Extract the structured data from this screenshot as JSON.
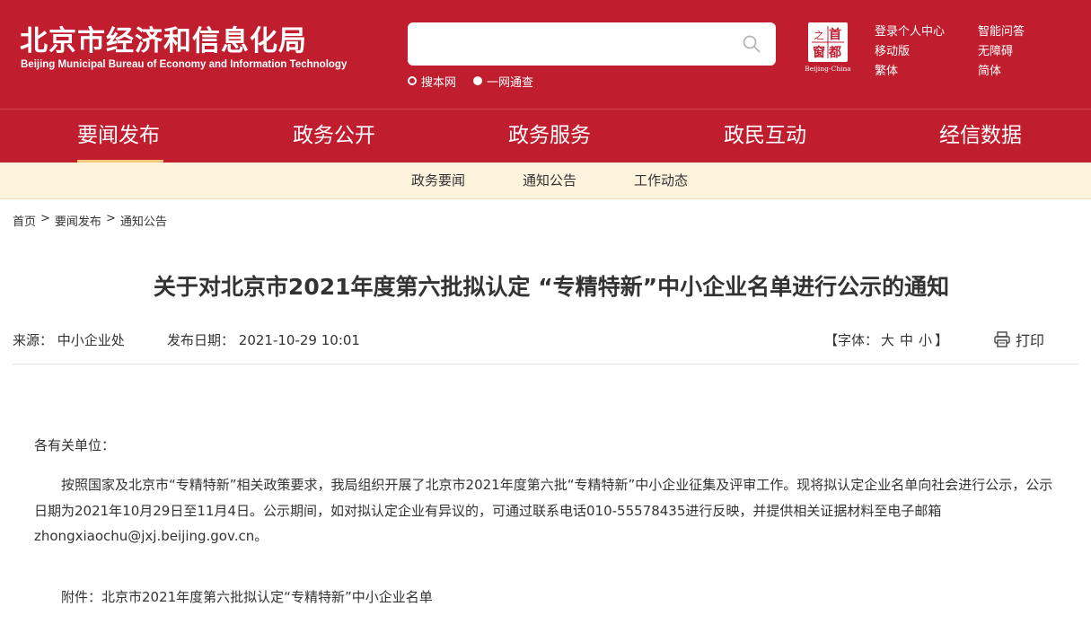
{
  "header": {
    "logo_cn": "北京市经济和信息化局",
    "logo_en": "Beijing Municipal Bureau of Economy and Information Technology",
    "search": {
      "placeholder": ""
    },
    "scope_options": [
      {
        "label": "搜本网",
        "selected": false
      },
      {
        "label": "一网通查",
        "selected": true
      }
    ],
    "seal": {
      "chars": [
        "首",
        "都",
        "之",
        "窗"
      ],
      "caption": "Beijing-China"
    },
    "links": {
      "login": "登录个人中心",
      "qa": "智能问答",
      "mobile": "移动版",
      "accessible": "无障碍",
      "traditional": "繁体",
      "simplified": "简体"
    }
  },
  "main_nav": {
    "items": [
      "要闻发布",
      "政务公开",
      "政务服务",
      "政民互动",
      "经信数据"
    ],
    "active": "要闻发布"
  },
  "sub_nav": {
    "items": [
      "政务要闻",
      "通知公告",
      "工作动态"
    ]
  },
  "breadcrumb": {
    "items": [
      "首页",
      "要闻发布",
      "通知公告"
    ],
    "separator": ">"
  },
  "article": {
    "title": "关于对北京市2021年度第六批拟认定 “专精特新”中小企业名单进行公示的通知",
    "source_label": "来源：",
    "source": "中小企业处",
    "date_label": "发布日期：",
    "date": "2021-10-29 10:01",
    "font_label": "【字体：",
    "font_sizes": [
      "大",
      "中",
      "小"
    ],
    "font_close": "】",
    "print_label": "打印",
    "salutation": "各有关单位：",
    "paragraph": "按照国家及北京市“专精特新”相关政策要求，我局组织开展了北京市2021年度第六批“专精特新”中小企业征集及评审工作。现将拟认定企业名单向社会进行公示，公示日期为2021年10月29日至11月4日。公示期间，如对拟认定企业有异议的，可通过联系电话010-55578435进行反映，并提供相关证据材料至电子邮箱zhongxiaochu@jxj.beijing.gov.cn。",
    "attachment": "附件：北京市2021年度第六批拟认定“专精特新”中小企业名单"
  },
  "colors": {
    "brand_red": "#c01e2f",
    "subnav_bg": "#fdf2dc",
    "active_underline": "#f4c57a"
  }
}
